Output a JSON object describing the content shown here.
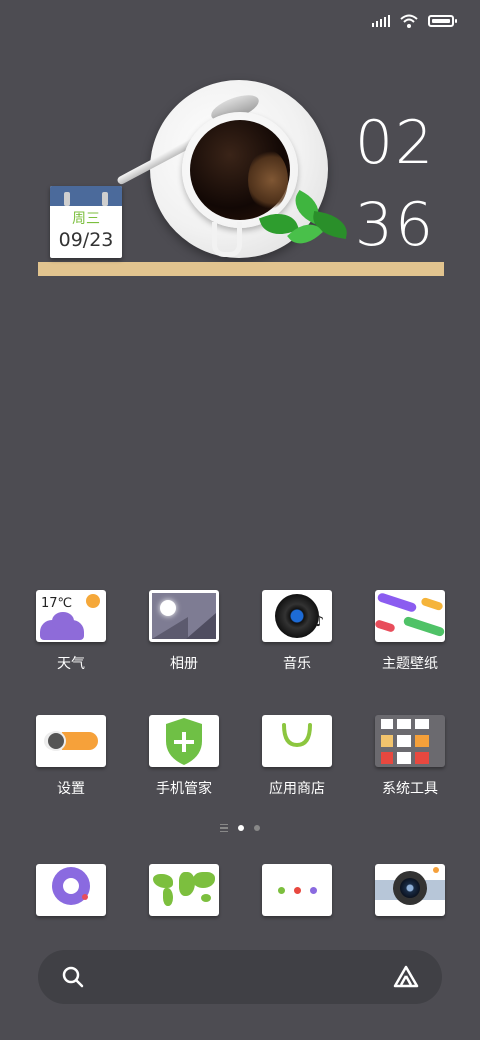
{
  "status_bar": {
    "signal_icon": "signal-icon",
    "wifi_icon": "wifi-icon",
    "battery_icon": "battery-icon"
  },
  "widget": {
    "weekday": "周三",
    "date": "09/23",
    "hour": "02",
    "minute": "36",
    "shelf_color": "#e2c48f"
  },
  "apps": [
    {
      "label": "天气",
      "icon": "weather-icon",
      "temperature": "17℃"
    },
    {
      "label": "相册",
      "icon": "gallery-icon"
    },
    {
      "label": "音乐",
      "icon": "music-icon"
    },
    {
      "label": "主题壁纸",
      "icon": "themes-icon"
    },
    {
      "label": "设置",
      "icon": "settings-icon"
    },
    {
      "label": "手机管家",
      "icon": "security-icon"
    },
    {
      "label": "应用商店",
      "icon": "app-store-icon"
    },
    {
      "label": "系统工具",
      "icon": "system-tools-icon"
    }
  ],
  "page_indicator": {
    "pages": 2,
    "active": 1
  },
  "dock": [
    {
      "icon": "phone-dialer-icon"
    },
    {
      "icon": "browser-map-icon"
    },
    {
      "icon": "messages-icon"
    },
    {
      "icon": "camera-icon"
    }
  ],
  "search_bar": {
    "search_icon": "search-icon",
    "assistant_icon": "assistant-icon"
  }
}
